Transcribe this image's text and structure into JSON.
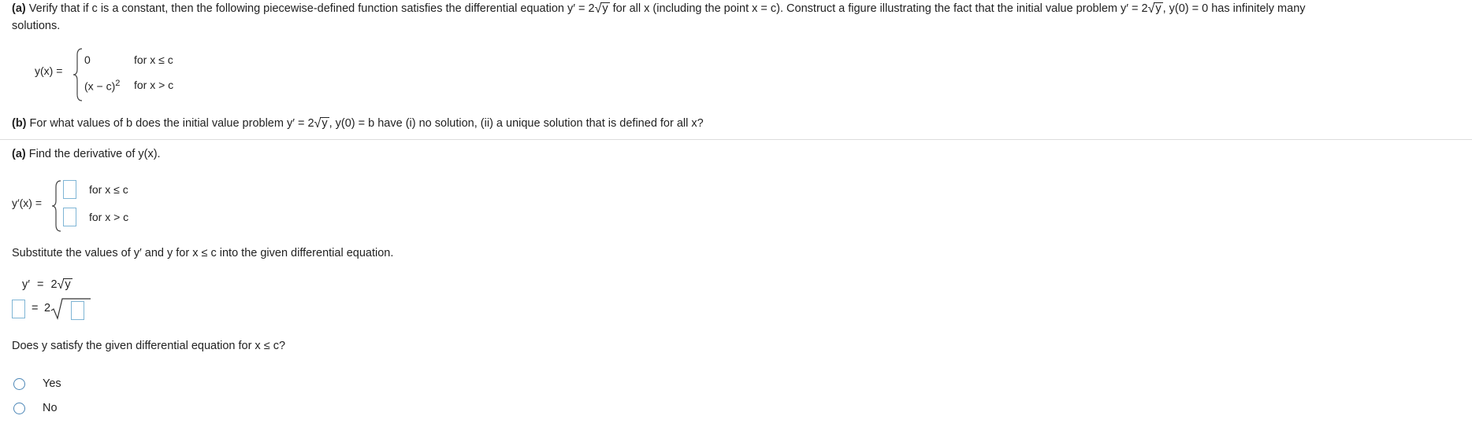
{
  "problem": {
    "part_a_label": "(a)",
    "part_a_text": "Verify that if c is a constant, then the following piecewise-defined function satisfies the differential equation y′ = 2",
    "part_a_sqrt": "y",
    "part_a_text2": " for all x (including the point x = c). Construct a figure illustrating the fact that the initial value problem y′ = 2",
    "part_a_sqrt2": "y",
    "part_a_text3": ", y(0) = 0 has infinitely many",
    "part_a_text4": "solutions.",
    "piecewise": {
      "lhs": "y(x) =",
      "row1_expr": "0",
      "row1_cond": "for x ≤ c",
      "row2_expr": "(x − c)",
      "row2_exp": "2",
      "row2_cond": "for x > c"
    },
    "part_b_label": "(b)",
    "part_b_text": "For what values of b does the initial value problem y′ = 2",
    "part_b_sqrt": "y",
    "part_b_text2": ", y(0) = b have (i) no solution, (ii) a unique solution that is defined for all x?"
  },
  "step1": {
    "label": "(a)",
    "text": "Find the derivative of y(x).",
    "lhs": "y′(x) =",
    "row1_cond": "for x ≤ c",
    "row2_cond": "for x > c"
  },
  "step2": {
    "text": "Substitute the values of y′ and y for x ≤ c into the given differential equation.",
    "eq_lhs": "y′",
    "eq_sign": "=",
    "eq_rhs_coef": "2",
    "eq_rhs_sqrt": "y",
    "eq2_sign": "=",
    "eq2_coef": "2"
  },
  "step3": {
    "question": "Does y satisfy the given differential equation for x ≤ c?",
    "options": [
      "Yes",
      "No"
    ]
  }
}
